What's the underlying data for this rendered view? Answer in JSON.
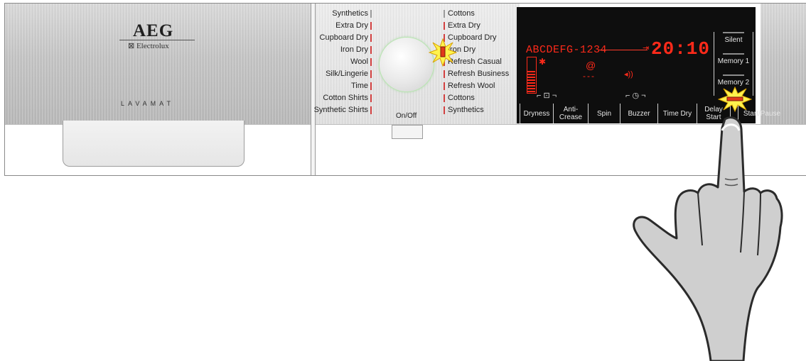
{
  "brand": {
    "logo": "AEG",
    "sub_logo": "⊠ Electrolux",
    "model": "LAVAMAT"
  },
  "programmes": {
    "left": [
      "Synthetics",
      "Extra Dry",
      "Cupboard Dry",
      "Iron Dry",
      "Wool",
      "Silk/Lingerie",
      "Time",
      "Cotton Shirts",
      "Synthetic Shirts"
    ],
    "right": [
      "Cottons",
      "Extra Dry",
      "Cupboard Dry",
      "Iron Dry",
      "Refresh Casual",
      "Refresh Business",
      "Refresh Wool",
      "Cottons",
      "Synthetics"
    ]
  },
  "onoff_label": "On/Off",
  "display": {
    "text": "ABCDEFG-1234",
    "time": "20:10",
    "colors": {
      "segment": "#ff2a1a",
      "background": "#0e0e0e"
    }
  },
  "buttons": [
    {
      "label": "Dryness"
    },
    {
      "label": "Anti-\nCrease"
    },
    {
      "label": "Spin"
    },
    {
      "label": "Buzzer"
    },
    {
      "label": "Time Dry"
    },
    {
      "label": "Delay\nStart"
    },
    {
      "label": "Start/Pause"
    }
  ],
  "side_buttons": [
    "Silent",
    "Memory 1",
    "Memory 2"
  ]
}
